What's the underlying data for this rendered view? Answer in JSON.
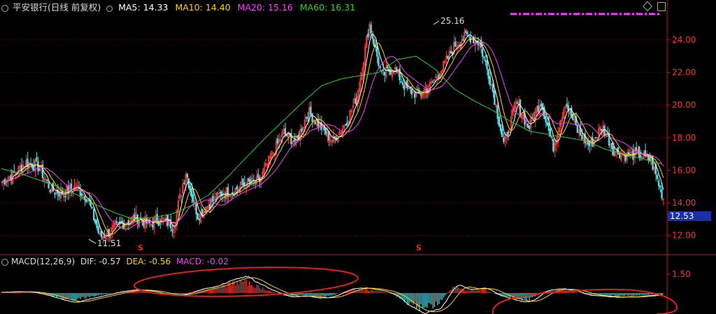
{
  "header": {
    "title": "平安银行(日线 前复权)",
    "ma_labels": [
      {
        "text": "MA5: 14.33",
        "color": "#ffffff"
      },
      {
        "text": "MA10: 14.40",
        "color": "#ffd400"
      },
      {
        "text": "MA20: 15.16",
        "color": "#ff3cff"
      },
      {
        "text": "MA60: 16.31",
        "color": "#33cc33"
      }
    ]
  },
  "indicator": {
    "name": "MACD(12,26,9)",
    "dif": "DIF: -0.57",
    "dea": "DEA: -0.56",
    "macd": "MACD: -0.02"
  },
  "price_tag": "12.53",
  "annotations": {
    "high": "25.16",
    "low": "11.51",
    "marker": "S"
  },
  "colors": {
    "up": "#ff3b3b",
    "down": "#54e0e8",
    "grid": "#5a0000",
    "axis": "#c01818",
    "axis_text": "#ff3030"
  },
  "chart_data": [
    {
      "type": "candlestick",
      "title": "平安银行(日线 前复权)",
      "ylim": [
        11,
        25.5
      ],
      "y_ticks": [
        "24.00",
        "22.00",
        "20.00",
        "18.00",
        "16.00",
        "14.00",
        "12.00"
      ],
      "max_label": "25.16",
      "min_label": "11.51",
      "last_price": "12.53",
      "close_path": [
        15.3,
        15.8,
        16.5,
        16.2,
        14.8,
        14.6,
        15.0,
        14.3,
        11.9,
        12.3,
        12.8,
        13.1,
        12.7,
        13.0,
        12.6,
        15.9,
        13.2,
        14.0,
        14.6,
        14.8,
        15.2,
        15.3,
        16.9,
        18.3,
        17.7,
        19.6,
        18.7,
        17.8,
        18.8,
        20.5,
        25.0,
        21.8,
        22.3,
        21.0,
        20.6,
        21.2,
        22.3,
        23.7,
        24.3,
        23.8,
        21.2,
        17.5,
        20.2,
        18.6,
        20.3,
        17.4,
        20.2,
        18.4,
        17.5,
        18.7,
        17.2,
        16.9,
        17.0,
        16.6,
        14.3
      ],
      "ma_series": [
        {
          "name": "MA5",
          "color": "#ffffff",
          "value": "14.33"
        },
        {
          "name": "MA10",
          "color": "#ffd400",
          "value": "14.40"
        },
        {
          "name": "MA20",
          "color": "#ff3cff",
          "value": "15.16"
        },
        {
          "name": "MA60",
          "color": "#33cc33",
          "value": "16.31",
          "values": [
            16.1,
            15.8,
            15.4,
            15.0,
            14.5,
            13.9,
            13.4,
            13.0,
            13.1,
            13.3,
            13.8,
            14.5,
            15.6,
            16.8,
            18.0,
            19.1,
            20.2,
            21.2,
            21.6,
            21.8,
            22.0,
            22.8,
            23.0,
            22.2,
            21.0,
            20.3,
            19.7,
            19.0,
            18.4,
            18.2,
            18.0,
            17.8,
            17.3,
            17.0,
            16.7,
            16.4
          ]
        }
      ]
    },
    {
      "type": "bar",
      "title": "MACD(12,26,9)",
      "y_ticks": [
        "1.50"
      ],
      "series": [
        {
          "name": "DIF",
          "value": "-0.57"
        },
        {
          "name": "DEA",
          "value": "-0.56"
        },
        {
          "name": "MACD",
          "value": "-0.02"
        }
      ],
      "hist_values": [
        0.05,
        0.1,
        0.06,
        -0.2,
        -0.5,
        -0.6,
        -0.3,
        -0.1,
        0.15,
        0.2,
        0.1,
        -0.15,
        -0.1,
        0.2,
        0.5,
        0.8,
        1.1,
        0.6,
        0.1,
        -0.3,
        -0.15,
        -0.4,
        -0.2,
        0.25,
        0.35,
        0.2,
        -0.1,
        -0.9,
        -1.4,
        -1.0,
        0.6,
        0.2,
        0.35,
        -0.2,
        -0.5,
        -0.6,
        0.15,
        0.3,
        0.15,
        -0.2,
        -0.2,
        -0.3,
        -0.25,
        -0.15,
        -0.05
      ]
    }
  ]
}
